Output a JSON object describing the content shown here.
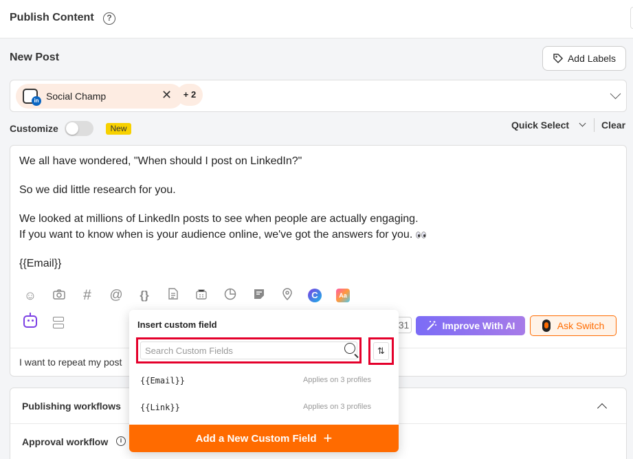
{
  "header": {
    "title": "Publish Content",
    "help_glyph": "?"
  },
  "post": {
    "section_title": "New Post",
    "add_labels_label": "Add Labels",
    "profile_chip_name": "Social Champ",
    "profile_chip_network_badge": "in",
    "extra_profiles_count": "+ 2"
  },
  "options": {
    "customize_label": "Customize",
    "customize_toggle_on": false,
    "new_badge": "New",
    "quick_select_label": "Quick Select",
    "clear_label": "Clear"
  },
  "editor": {
    "lines": [
      "We all have wondered, \"When should I post on LinkedIn?\"",
      "So we did little research for you.",
      "We looked at millions of LinkedIn posts to see when people are actually engaging.",
      "If you want to know when is your audience online, we've got the answers for you.",
      "{{Email}}"
    ],
    "toolbar_icons": [
      "emoji-icon",
      "camera-icon",
      "hashtag-icon",
      "mention-icon",
      "custom-field-icon",
      "document-icon",
      "drafts-icon",
      "chart-icon",
      "note-icon",
      "location-icon",
      "canva-icon",
      "text-style-icon"
    ],
    "canva_glyph": "C",
    "text_style_glyph": "Aa",
    "calendar_fragment": "31",
    "improve_ai_label": "Improve With AI",
    "ask_switch_label": "Ask Switch",
    "repeat_text": "I want to repeat my post"
  },
  "workflows": {
    "title": "Publishing workflows",
    "approval_label": "Approval workflow",
    "info_glyph": "i"
  },
  "custom_field_popup": {
    "title": "Insert custom field",
    "search_placeholder": "Search Custom Fields",
    "sort_glyph": "⇅",
    "fields": [
      {
        "name": "{{Email}}",
        "applies": "Applies on 3 profiles"
      },
      {
        "name": "{{Link}}",
        "applies": "Applies on 3 profiles"
      }
    ],
    "add_button_label": "Add a New Custom Field",
    "add_button_glyph": "+"
  },
  "colors": {
    "accent_orange": "#ff6b00",
    "highlight_red": "#e4002b",
    "ai_purple": "#7b6cf6",
    "chip_bg": "#fdece2",
    "linkedin_blue": "#0a66c2"
  }
}
